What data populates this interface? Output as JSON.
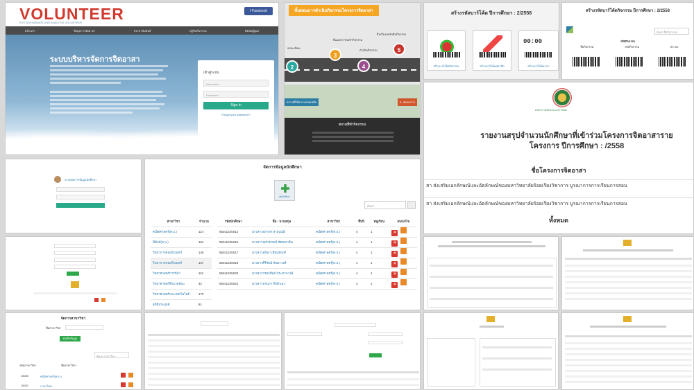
{
  "volunteer_site": {
    "logo": "VOLUNTEER",
    "tagline": "SYSTEM MANAGE AND ANALYSIS VOLUNTEER",
    "facebook": "f Facebook",
    "nav": [
      "หน้าแรก",
      "ข้อมูลการจัดอาสา",
      "ประชาสัมพันธ์",
      "ปฏิทินกิจกรรม",
      "ติดต่อผู้ดูแล"
    ],
    "headline": "ระบบบริหารจัดการจิตอาสา",
    "login_title": "เข้าสู่ระบบ",
    "username_placeholder": "Username",
    "password_placeholder": "Password",
    "signin": "Sign in",
    "forgot": "Forgot your password?"
  },
  "steps_site": {
    "banner": "ขั้นตอนการดำเนินกิจกรรมโครงการจิตอาสา",
    "labels": [
      "ยื่นเอกสารขอทำกิจกรรม",
      "ยื่นเรื่องขอรับคืนกิจกรรม",
      "ดำเนินกิจกรรม",
      "ลงทะเบียน"
    ],
    "numbers": [
      "2",
      "3",
      "4",
      "5"
    ],
    "btn_a": "สถานที่ให้ความช่วยเหลือ",
    "btn_b": "8. ส่งเอกสาร",
    "footer_title": "สถานที่ทำกิจกรรม"
  },
  "barcode_menu": {
    "title": "สร้างรหัสบาร์โค้ด ปีการศึกษา : 2/2558",
    "tiles": [
      "สร้างบาร์โค้ดกิจกรรม",
      "สร้างบาร์โค้ดสมาชิก",
      "สร้างบาร์โค้ดเวลา"
    ],
    "clock": "00:00"
  },
  "barcode_list": {
    "title": "สร้างรหัสบาร์โค้ดกิจกรรม ปีการศึกษา : 2/2558",
    "search": "ค้นหาชื่อกิจกรรม...",
    "heading": "รหัสกิจกรรม",
    "cols": [
      "ชื่อกิจกรรม",
      "รหัสกิจกรรม",
      "สถานะ"
    ]
  },
  "report": {
    "org": "ฝ่ายกิจการนักศึกษาและกิจการพิเศษ",
    "title": "รายงานสรุปจำนวนนักศึกษาที่เข้าร่วมโครงการจิตอาสารายโครงการ ปีการศึกษา : /2558",
    "project_header": "ชื่อโครงการจิตอาสา",
    "rows": [
      "สา ส่งเสริมเอกลักษณ์และอัตลักษณ์ของมหาวิทยาลัยร้อยเรียงวิชาการ บูรณาการการเรียนการสอน",
      "สา ส่งเสริมเอกลักษณ์และอัตลักษณ์ของมหาวิทยาลัยร้อยเรียงวิชาการ บูรณาการการเรียนการสอน"
    ],
    "total": "ทั้งหมด"
  },
  "small_login": {
    "title": "ระบบจัดการข้อมูลนักศึกษา"
  },
  "students": {
    "title": "จัดการข้อมูลนักศึกษา",
    "add_caption": "เพิ่มนักศึกษา",
    "search_placeholder": "ค้นหา...",
    "left_headers": [
      "สาขาวิชา",
      "จำนวน"
    ],
    "left_rows": [
      [
        "คณิตศาสตร์(ค.บ.)",
        "114"
      ],
      [
        "ฟิสิกส์(ค.บ.)",
        "164"
      ],
      [
        "วิทยาการคอมพิวเตอร์",
        "140"
      ],
      [
        "วิทยาการคอมพิวเตอร์",
        "147"
      ],
      [
        "วิทยาศาสตร์การกีฬา",
        "110"
      ],
      [
        "วิทยาศาสตร์สิ่งแวดล้อม",
        "42"
      ],
      [
        "วิทยาศาสตร์และเทคโนโลยี",
        "170"
      ],
      [
        "สถิติประยุกต์",
        "91"
      ]
    ],
    "right_headers": [
      "รหัสนักศึกษา",
      "ชื่อ - นามสกุล",
      "สาขาวิชา",
      "ชั้นปี",
      "หมู่เรียน",
      "ลบ/แก้ไข"
    ],
    "right_rows": [
      [
        "55011225012",
        "นางสาวสุภาพร สายบุญมี",
        "คณิตศาสตร์(ค.บ.)",
        "4",
        "1"
      ],
      [
        "55011225015",
        "นางสาวจุฬาลักษณ์ ชัยคณาสิน",
        "คณิตศาสตร์(ค.บ.)",
        "4",
        "1"
      ],
      [
        "55011225017",
        "นางสาวสุนิษา เทียมทัณฑ์",
        "คณิตศาสตร์(ค.บ.)",
        "4",
        "1"
      ],
      [
        "55011225018",
        "นางสาวศิริรัตน์ ทันตะวงศ์",
        "คณิตศาสตร์(ค.บ.)",
        "4",
        "1"
      ],
      [
        "55011225020",
        "นางสาวกรองทิพย์ ประทานวงษ์",
        "คณิตศาสตร์(ค.บ.)",
        "4",
        "1"
      ],
      [
        "55011225022",
        "นางสาวพรนภา พึ่งตัวเอง",
        "คณิตศาสตร์(ค.บ.)",
        "4",
        "1"
      ]
    ]
  },
  "faculty": {
    "title": "จัดการสาขาวิชา",
    "field": "ชื่อสาขาวิชา",
    "save": "บันทึกข้อมูล",
    "search": "ค้นหาสาขาวิชา...",
    "headers": [
      "รหัสสาขาวิชา",
      "ชื่อสาขาวิชา"
    ],
    "rows": [
      [
        "15000",
        "คณิตศาสตร์(ค.บ.)"
      ],
      [
        "15001",
        "ภาษาไทย"
      ]
    ]
  },
  "misc": {
    "report_small": "รายงานสรุปจำนวนนักศึกษา",
    "check": "ตรวจสอบ"
  }
}
